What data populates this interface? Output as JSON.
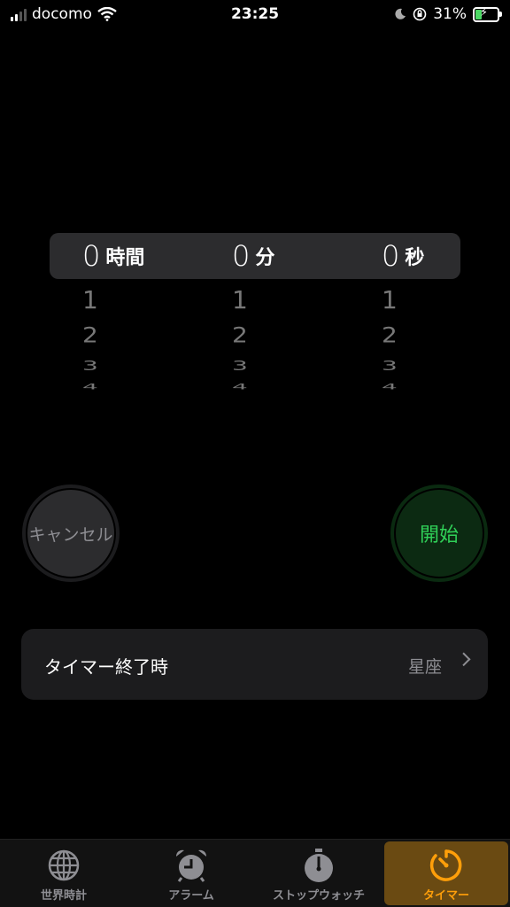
{
  "status_bar": {
    "carrier": "docomo",
    "time": "23:25",
    "battery": "31%"
  },
  "picker": {
    "hours": {
      "value": "0",
      "unit": "時間",
      "below": [
        "1",
        "2",
        "3",
        "4"
      ]
    },
    "minutes": {
      "value": "0",
      "unit": "分",
      "below": [
        "1",
        "2",
        "3",
        "4"
      ]
    },
    "seconds": {
      "value": "0",
      "unit": "秒",
      "below": [
        "1",
        "2",
        "3",
        "4"
      ]
    }
  },
  "buttons": {
    "cancel": "キャンセル",
    "start": "開始"
  },
  "when_timer_ends": {
    "label": "タイマー終了時",
    "value": "星座"
  },
  "tabs": [
    {
      "label": "世界時計",
      "icon": "globe-icon"
    },
    {
      "label": "アラーム",
      "icon": "alarm-clock-icon"
    },
    {
      "label": "ストップウォッチ",
      "icon": "stopwatch-icon"
    },
    {
      "label": "タイマー",
      "icon": "timer-icon",
      "selected": true
    }
  ],
  "colors": {
    "accent": "#ff9f0a",
    "start_green": "#30d158",
    "secondary_text": "#8e8e93"
  }
}
